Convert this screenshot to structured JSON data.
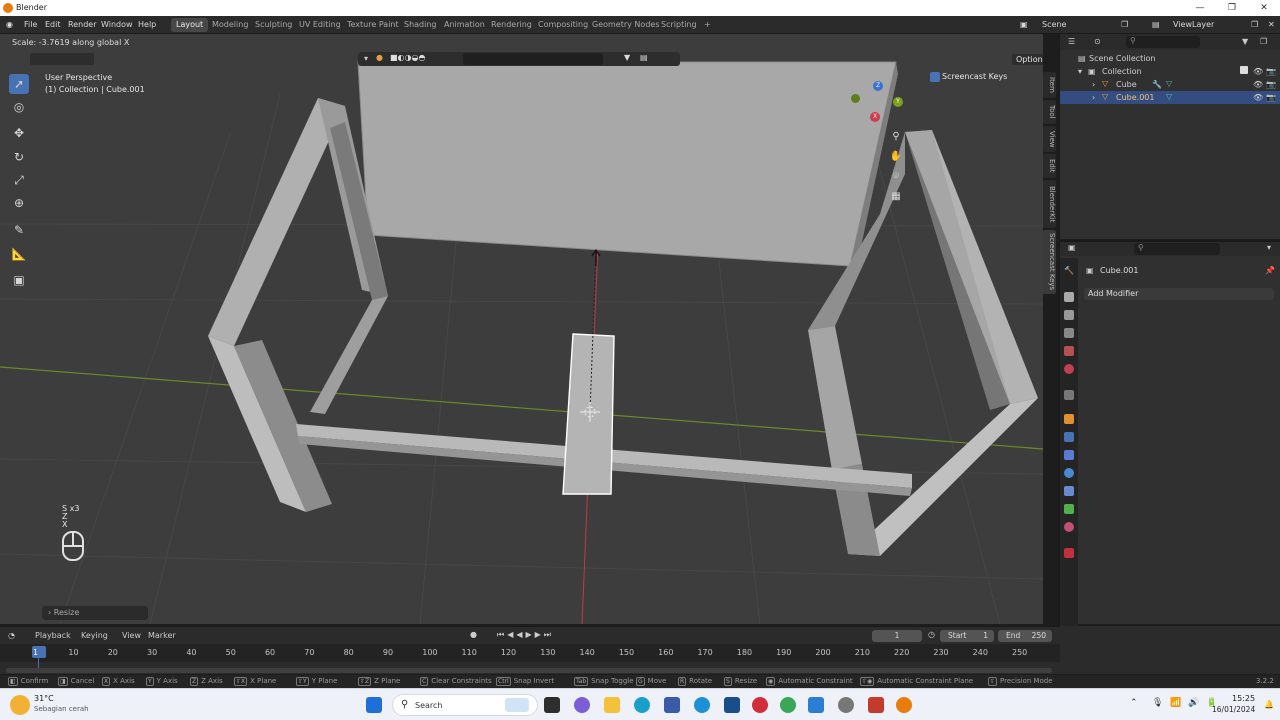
{
  "window": {
    "title": "Blender",
    "controls": [
      "—",
      "❐",
      "✕"
    ]
  },
  "menu": [
    "File",
    "Edit",
    "Render",
    "Window",
    "Help"
  ],
  "workspaces": [
    "Layout",
    "Modeling",
    "Sculpting",
    "UV Editing",
    "Texture Paint",
    "Shading",
    "Animation",
    "Rendering",
    "Compositing",
    "Geometry Nodes",
    "Scripting",
    "+"
  ],
  "active_workspace": "Layout",
  "scene": {
    "scene_label": "Scene",
    "viewlayer_label": "ViewLayer"
  },
  "viewport": {
    "operator_text": "Scale: -3.7619 along global X",
    "view_name": "User Perspective",
    "collection_info": "(1) Collection | Cube.001",
    "options_label": "Options",
    "screencast_label": "Screencast Keys",
    "keys_pressed": [
      "S x3",
      "Z",
      "X"
    ],
    "last_op": "Resize",
    "side_tabs": [
      "Item",
      "Tool",
      "View",
      "Edit",
      "BlenderKit",
      "Screencast Keys"
    ],
    "gizmo": {
      "z": "Z",
      "y": "Y",
      "x": "X"
    }
  },
  "outliner": {
    "rows": [
      {
        "label": "Scene Collection",
        "indent": 0
      },
      {
        "label": "Collection",
        "indent": 1
      },
      {
        "label": "Cube",
        "indent": 2
      },
      {
        "label": "Cube.001",
        "indent": 2,
        "selected": true
      }
    ]
  },
  "properties": {
    "object_name": "Cube.001",
    "add_modifier": "Add Modifier"
  },
  "timeline": {
    "menus": [
      "Playback",
      "Keying",
      "View",
      "Marker"
    ],
    "current_frame": "1",
    "start_label": "Start",
    "start_value": "1",
    "end_label": "End",
    "end_value": "250",
    "ticks": [
      "1",
      "10",
      "20",
      "30",
      "40",
      "50",
      "60",
      "70",
      "80",
      "90",
      "100",
      "110",
      "120",
      "130",
      "140",
      "150",
      "160",
      "170",
      "180",
      "190",
      "200",
      "210",
      "220",
      "230",
      "240",
      "250"
    ]
  },
  "statusbar": {
    "items": [
      "Confirm",
      "Cancel",
      "X Axis",
      "Y Axis",
      "Z Axis",
      "X Plane",
      "Y Plane",
      "Z Plane",
      "Clear Constraints",
      "Snap Invert",
      "Snap Toggle",
      "Move",
      "Rotate",
      "Resize",
      "Automatic Constraint",
      "Automatic Constraint Plane",
      "Precision Mode"
    ],
    "version": "3.2.2"
  },
  "taskbar": {
    "weather_temp": "31°C",
    "weather_desc": "Sebagian cerah",
    "search_placeholder": "Search",
    "time": "15:25",
    "date": "16/01/2024"
  },
  "colors": {
    "accent": "#4772b3",
    "selection": "#334d80",
    "object_face": "#a6a6a6",
    "x_axis": "#d33a4b",
    "y_axis": "#7ea11c"
  }
}
